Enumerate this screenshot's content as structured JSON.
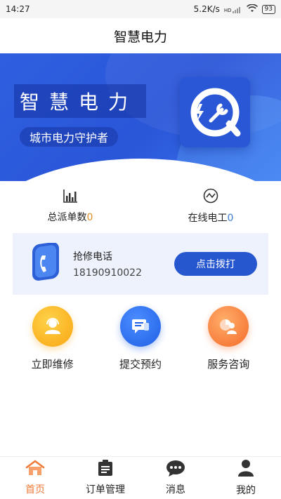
{
  "status_bar": {
    "time": "14:27",
    "network_speed": "5.2K/s",
    "signal_label": "HD",
    "battery": "93"
  },
  "header": {
    "title": "智慧电力"
  },
  "banner": {
    "title": "智慧电力",
    "subtitle": "城市电力守护者",
    "logo_icon": "lightning-wrench-logo-icon"
  },
  "stats": [
    {
      "label": "总派单数",
      "value": "0",
      "icon": "bar-chart-icon",
      "value_color": "#e0902a"
    },
    {
      "label": "在线电工",
      "value": "0",
      "icon": "trend-circle-icon",
      "value_color": "#3a7bd5"
    }
  ],
  "hotline": {
    "title": "抢修电话",
    "phone": "18190910022",
    "button_label": "点击拨打",
    "icon": "phone-icon"
  },
  "actions": [
    {
      "label": "立即维修",
      "icon": "repair-person-icon",
      "color": "#f8a511"
    },
    {
      "label": "提交预约",
      "icon": "chat-message-icon",
      "color": "#1f5fe6"
    },
    {
      "label": "服务咨询",
      "icon": "consult-person-icon",
      "color": "#f56a2a"
    }
  ],
  "bottom_nav": {
    "items": [
      {
        "label": "首页",
        "icon": "home-icon",
        "active": true
      },
      {
        "label": "订单管理",
        "icon": "clipboard-icon",
        "active": false
      },
      {
        "label": "消息",
        "icon": "message-bubble-icon",
        "active": false
      },
      {
        "label": "我的",
        "icon": "user-icon",
        "active": false
      }
    ]
  },
  "colors": {
    "primary": "#2657cf",
    "active_tab": "#f07a3a"
  }
}
